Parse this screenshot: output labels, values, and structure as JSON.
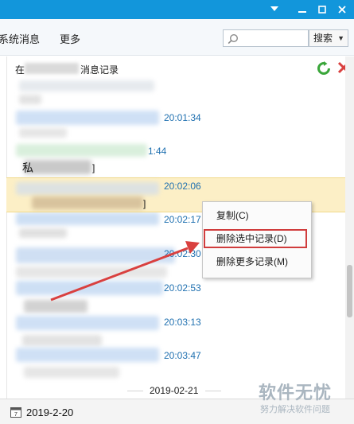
{
  "window": {
    "controls": [
      "chevron-down-icon",
      "minimize-icon",
      "maximize-icon",
      "close-icon"
    ],
    "title_bar_color": "#1296db"
  },
  "toolbar": {
    "tab_messages": "系统消息",
    "tab_more": "更多",
    "search_placeholder": "",
    "search_scope": "搜索"
  },
  "history": {
    "header_prefix": "在",
    "header_suffix": "消息记录",
    "times": [
      "20:01:34",
      "1:44",
      "20:02:06",
      "20:02:17",
      "20:02:30",
      "20:02:53",
      "20:03:13",
      "20:03:47"
    ],
    "bracket_1": "]",
    "bracket_2": "]",
    "date_separator": "2019-02-21"
  },
  "context_menu": {
    "copy": "复制(C)",
    "delete_selected": "删除选中记录(D)",
    "delete_more": "删除更多记录(M)"
  },
  "bottom": {
    "date": "2019-2-20"
  },
  "watermark": {
    "title": "软件无忧",
    "subtitle": "努力解决软件问题"
  },
  "colors": {
    "accent": "#1296db",
    "timestamp": "#1f70b0",
    "selection": "#fcefc6",
    "highlight_box": "#d03c3c",
    "arrow": "#d9403f"
  }
}
